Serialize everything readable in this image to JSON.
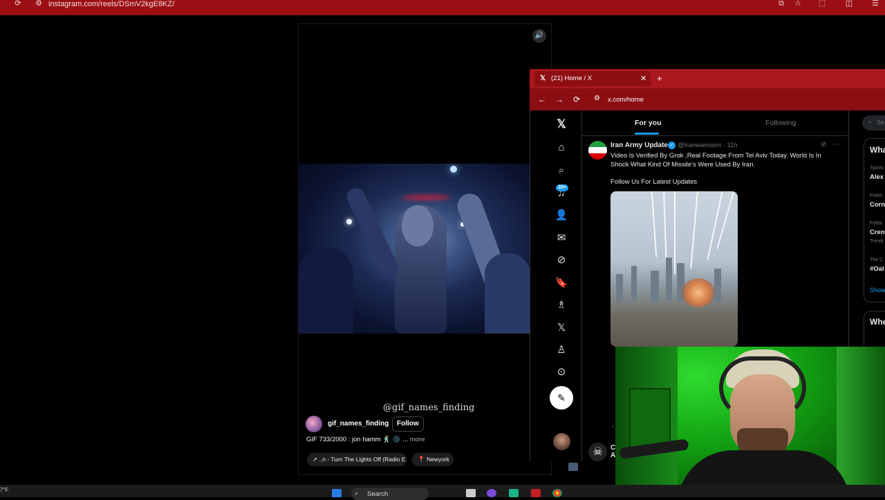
{
  "browser": {
    "url": "instagram.com/reels/DSmV2kgE8KZ/"
  },
  "reel": {
    "watermark": "@gif_names_finding",
    "username": "gif_names_finding",
    "follow_label": "Follow",
    "caption": "GIF 733/2000 : jon hamm 🕺 🌑 ...",
    "caption_more": "more",
    "audio": "↗ ..n - Turn The Lights Off (Radio E",
    "location": "📍 Newyork"
  },
  "window2": {
    "tab_icon": "𝕏",
    "tab_title": "(21) Home / X",
    "url": "x.com/home"
  },
  "x": {
    "notification_badge": "20+",
    "tabs": {
      "for_you": "For you",
      "following": "Following"
    },
    "post": {
      "name": "Iran Army Update",
      "handle": "@Iranwarroom · 11h",
      "text": "Video Is Verified By Grok ,Real Footage From Tel Aviv Today. World Is In Shock What Kind Of Missile's Were Used By Iran.",
      "text2": "Follow Us For Latest Updates"
    },
    "post2": {
      "name_partial": "C",
      "sub_partial": "A"
    },
    "right": {
      "search_placeholder": "Se",
      "trends_heading": "Wha",
      "t1_cat": "Sports",
      "t1_name": "Alex",
      "t2_cat": "Politic",
      "t2_name": "Corn",
      "t3_cat": "Politic",
      "t3_name": "Cren",
      "t3_sub": "Trendi",
      "t4_cat": "The C",
      "t4_name": "#Oal",
      "show_more": "Show",
      "who_heading": "Whe"
    }
  },
  "taskbar": {
    "temp": "7°F",
    "search": "Search"
  },
  "colors": {
    "chrome_red": "#9b0f14",
    "x_blue": "#1d9bf0",
    "webcam_green": "#14a814"
  }
}
